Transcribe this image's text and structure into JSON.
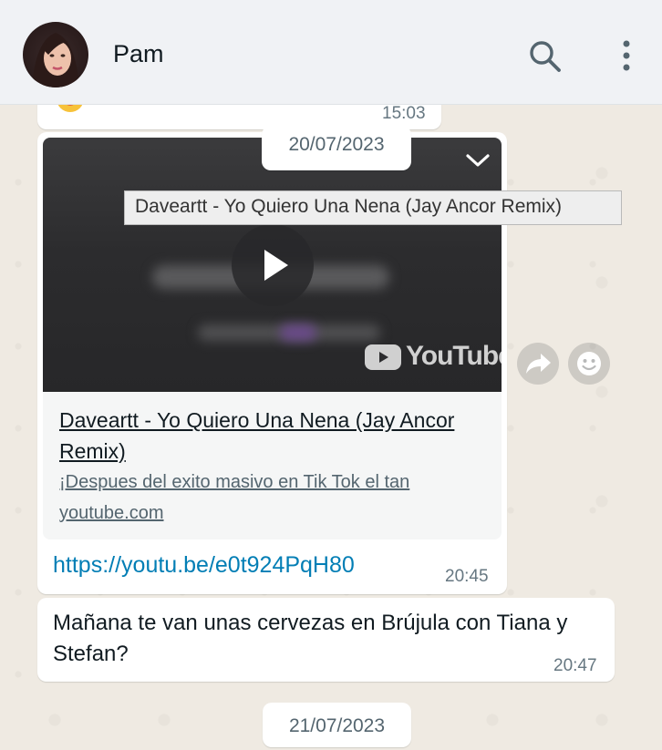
{
  "header": {
    "contact_name": "Pam",
    "avatar_icon": "contact-avatar",
    "search_icon": "search-icon",
    "menu_icon": "kebab-menu-icon"
  },
  "prev_message": {
    "time": "15:03",
    "emoji_icon": "smiley-emoji"
  },
  "date_chips": [
    "20/07/2023",
    "21/07/2023"
  ],
  "link_message": {
    "tooltip": "Daveartt - Yo Quiero Una Nena (Jay Ancor Remix)",
    "preview_title": "Daveartt - Yo Quiero Una Nena (Jay Ancor Remix)",
    "preview_description": "¡Despues del exito masivo en Tik Tok el tan",
    "preview_domain": "youtube.com",
    "youtube_label": "YouTube",
    "url": "https://youtu.be/e0t924PqH80",
    "time": "20:45"
  },
  "text_message": {
    "text": "Mañana te van unas cervezas en Brújula con Tiana y Stefan?",
    "time": "20:47"
  },
  "colors": {
    "chat_background": "#efeae2",
    "header_background": "#f0f2f5",
    "link_color": "#027eb5",
    "bubble_color": "#ffffff"
  }
}
